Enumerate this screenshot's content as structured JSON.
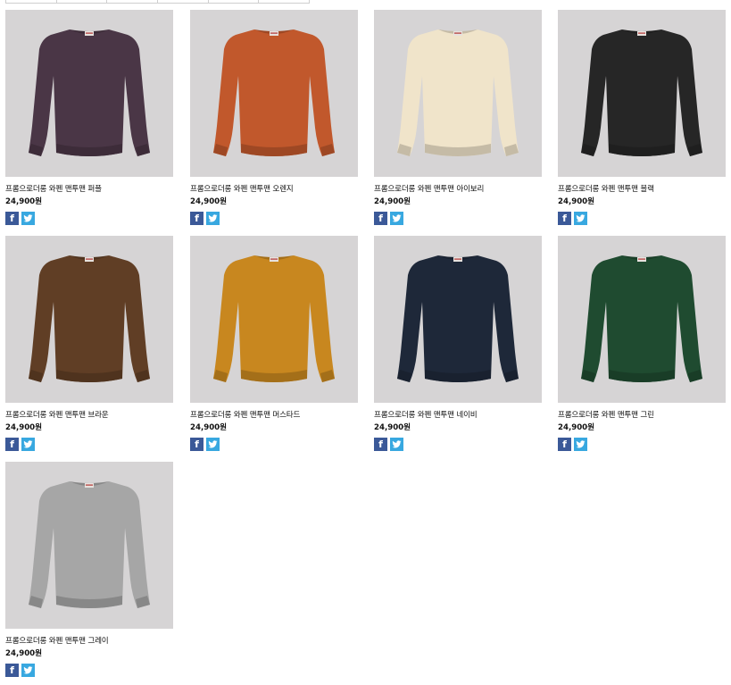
{
  "share": {
    "facebook_glyph": "f"
  },
  "products": [
    {
      "name": "프롬으로더롱 와펜 맨투맨 퍼플",
      "price": "24,900원",
      "color": "#4a3646"
    },
    {
      "name": "프롬으로더롱 와펜 맨투맨 오렌지",
      "price": "24,900원",
      "color": "#c1582c"
    },
    {
      "name": "프롬으로더롱 와펜 맨투맨 아이보리",
      "price": "24,900원",
      "color": "#f0e4ca"
    },
    {
      "name": "프롬으로더롱 와펜 맨투맨 블랙",
      "price": "24,900원",
      "color": "#262626"
    },
    {
      "name": "프롬으로더롱 와펜 맨투맨 브라운",
      "price": "24,900원",
      "color": "#603e25"
    },
    {
      "name": "프롬으로더롱 와펜 맨투맨 머스타드",
      "price": "24,900원",
      "color": "#c8871f"
    },
    {
      "name": "프롬으로더롱 와펜 맨투맨 네이비",
      "price": "24,900원",
      "color": "#1e2839"
    },
    {
      "name": "프롬으로더롱 와펜 맨투맨 그린",
      "price": "24,900원",
      "color": "#1f4b30"
    },
    {
      "name": "프롬으로더롱 와펜 맨투맨 그레이",
      "price": "24,900원",
      "color": "#a6a6a6"
    }
  ]
}
